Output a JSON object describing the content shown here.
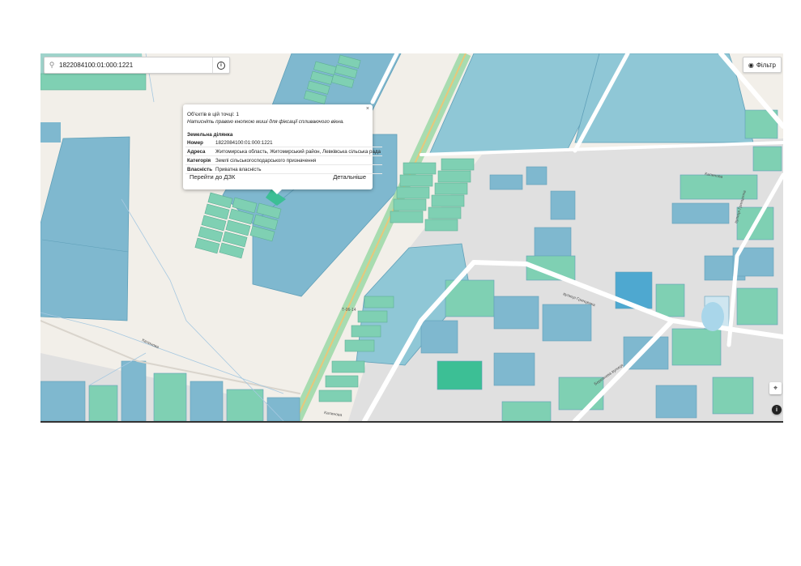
{
  "search": {
    "value": "1822084100:01:000:1221"
  },
  "filter": {
    "label": "Фільтр"
  },
  "popup": {
    "count_text": "Об'єктів в цій точці: 1",
    "hint_text": "Натисніть правою кнопкою миші для фіксації спливаючого вікна.",
    "close": "×",
    "section_title": "Земельна ділянка",
    "rows": [
      {
        "key": "Номер",
        "value": "1822084100:01:000:1221"
      },
      {
        "key": "Адреса",
        "value": "Житомирська область, Житомирський район, Левківська сільська рада"
      },
      {
        "key": "Категорія",
        "value": "Землі сільськогосподарського призначення"
      },
      {
        "key": "Власність",
        "value": "Приватна власність"
      }
    ],
    "action_goto": "Перейти до ДЗК",
    "action_details": "Детальніше"
  },
  "map_labels": {
    "highway": "Т-06-14",
    "street_1": "вулиця Гринценка",
    "street_2": "Березнева вулиця",
    "street_3": "Калинова",
    "street_4": "Калинова",
    "street_5": "вулиця Гринценка",
    "street_6": "Калинова"
  },
  "colors": {
    "blue_parcel": "#7fb8cf",
    "green_parcel": "#7fd0b3",
    "road": "#ffffff",
    "land": "#f2efe9",
    "urban": "#e0e0e0",
    "highway_green": "#7ccf9a"
  }
}
